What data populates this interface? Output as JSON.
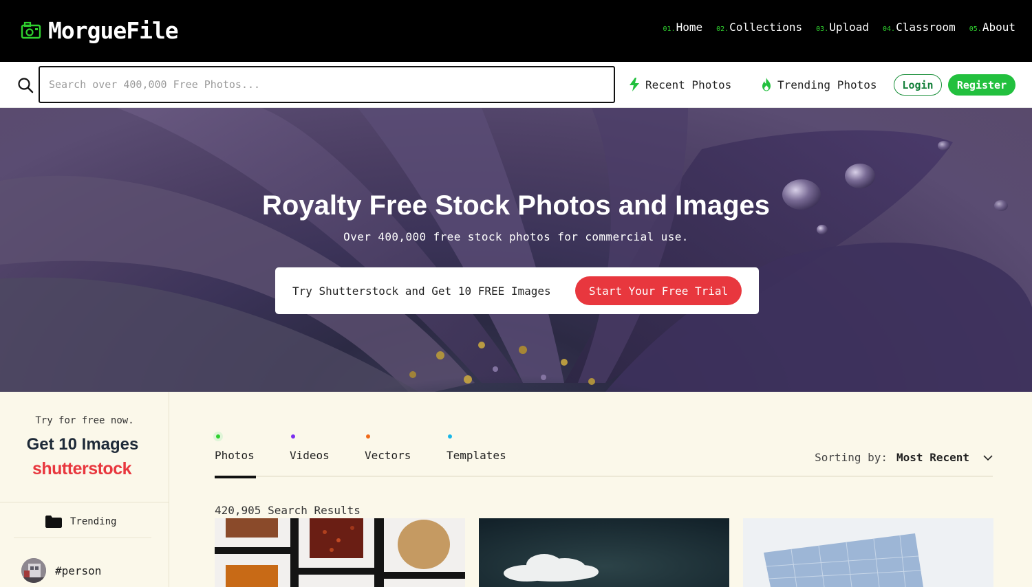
{
  "brand": {
    "name": "MorgueFile",
    "accent": "#2fd12f"
  },
  "nav": [
    {
      "num": "01.",
      "label": "Home"
    },
    {
      "num": "02.",
      "label": "Collections"
    },
    {
      "num": "03.",
      "label": "Upload"
    },
    {
      "num": "04.",
      "label": "Classroom"
    },
    {
      "num": "05.",
      "label": "About"
    }
  ],
  "search": {
    "placeholder": "Search over 400,000 Free Photos..."
  },
  "quicklinks": {
    "recent": "Recent Photos",
    "trending": "Trending Photos"
  },
  "auth": {
    "login": "Login",
    "register": "Register"
  },
  "hero": {
    "title": "Royalty Free Stock Photos and Images",
    "subtitle": "Over 400,000 free stock photos for commercial use.",
    "promo_text": "Try Shutterstock and Get 10 FREE Images",
    "promo_button": "Start Your Free Trial"
  },
  "sidebar": {
    "try_text": "Try for free now.",
    "get_text": "Get 10 Images",
    "shutterstock": "shutterstock",
    "trending_label": "Trending",
    "tag": "#person"
  },
  "tabs": [
    {
      "label": "Photos",
      "dot_color": "#2fd12f",
      "active": true
    },
    {
      "label": "Videos",
      "dot_color": "#7b2ff0",
      "active": false
    },
    {
      "label": "Vectors",
      "dot_color": "#f06a1a",
      "active": false
    },
    {
      "label": "Templates",
      "dot_color": "#19b7e8",
      "active": false
    }
  ],
  "sorting": {
    "label": "Sorting by:",
    "value": "Most Recent"
  },
  "results": {
    "count_text": "420,905 Search Results"
  }
}
